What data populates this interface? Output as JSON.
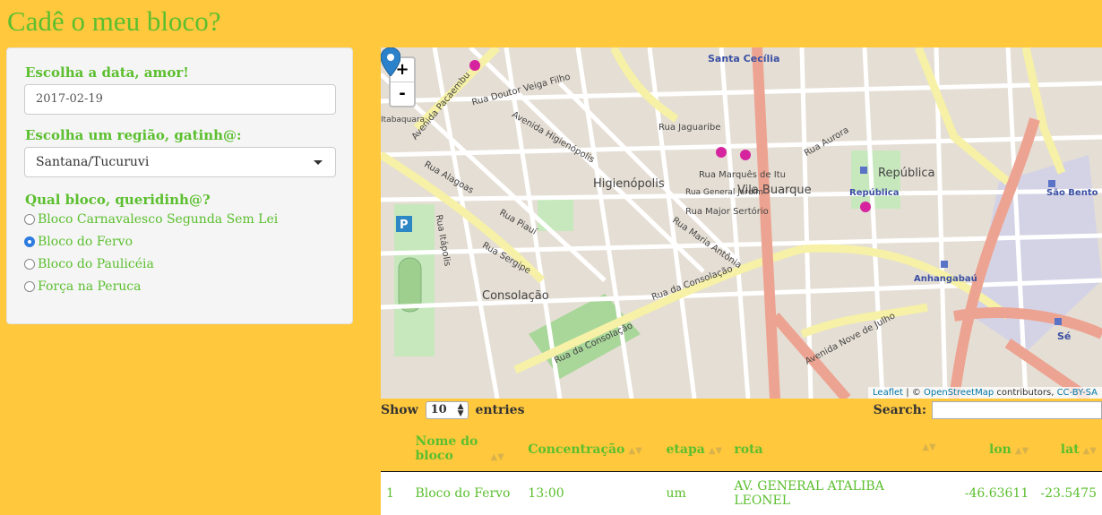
{
  "page": {
    "title": "Cadê o meu bloco?"
  },
  "sidebar": {
    "date_label": "Escolha a data, amor!",
    "date_value": "2017-02-19",
    "region_label": "Escolha um região, gatinh@:",
    "region_value": "Santana/Tucuruvi",
    "bloco_label": "Qual bloco, queridinh@?",
    "blocos": [
      {
        "label": "Bloco Carnavalesco Segunda Sem Lei",
        "checked": false
      },
      {
        "label": "Bloco do Fervo",
        "checked": true
      },
      {
        "label": "Bloco do Paulicéia",
        "checked": false
      },
      {
        "label": "Força na Peruca",
        "checked": false
      }
    ]
  },
  "map": {
    "zoom_in": "+",
    "zoom_out": "-",
    "attribution": {
      "leaflet": "Leaflet",
      "sep1": " | © ",
      "osm": "OpenStreetMap",
      "mid": " contributors, ",
      "license": "CC-BY-SA"
    },
    "labels": {
      "santa_cecilia": "Santa Cecília",
      "higienopolis": "Higienópolis",
      "vila_buarque": "Vila Buarque",
      "republica_area": "República",
      "republica_station": "República",
      "sao_bento": "São Bento",
      "anhangabau": "Anhangabaú",
      "consolacao": "Consolação",
      "se": "Sé",
      "rua_consolacao": "Rua da Consolação",
      "rua_consolacao2": "Rua da Consolação",
      "avenida_pacaembu": "Avenida Pacaembu",
      "avenida_higienopolis": "Avenida Higienópolis",
      "rua_jaguaribe": "Rua Jaguaribe",
      "rua_marques_itu": "Rua Marquês de Itu",
      "rua_major_sertorio": "Rua Major Sertório",
      "rua_maria_antonia": "Rua Maria Antônia",
      "avenida_nove_julho": "Avenida Nove de Julho",
      "rua_piaui": "Rua Piauí",
      "rua_sergipe": "Rua Sergipe",
      "rua_alagoas": "Rua Alagoas",
      "rua_itapolis": "Rua Itápolis",
      "rua_aurora": "Rua Aurora",
      "general_jardim": "Rua General Jardim",
      "rua_dr_veiga_filho": "Rua Doutor Veiga Filho",
      "itabaquara": "Itabaquara"
    }
  },
  "table": {
    "show_label": "Show",
    "entries_value": "10",
    "entries_label": "entries",
    "search_label": "Search:",
    "columns": [
      "",
      "Nome do bloco",
      "Concentração",
      "etapa",
      "rota",
      "lon",
      "lat"
    ],
    "rows": [
      [
        "1",
        "Bloco do Fervo",
        "13:00",
        "um",
        "AV. GENERAL ATALIBA LEONEL",
        "-46.63611",
        "-23.5475"
      ]
    ]
  }
}
